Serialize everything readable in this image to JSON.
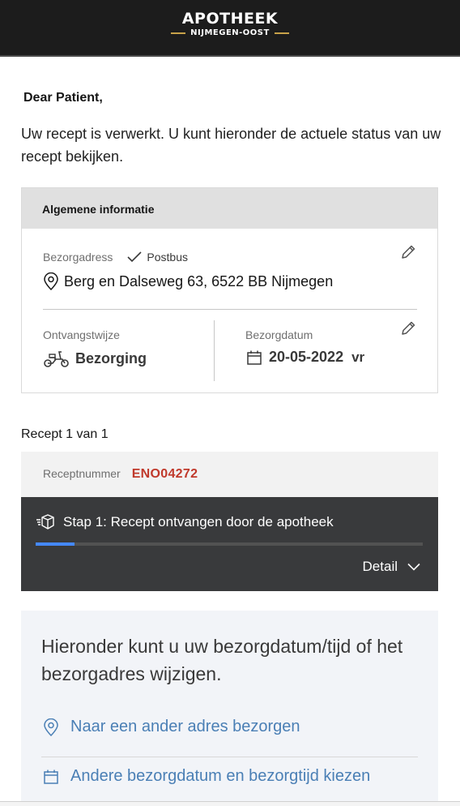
{
  "brand": {
    "name": "APOTHEEK",
    "subtitle": "NIJMEGEN-OOST",
    "accent_color": "#c8a24a"
  },
  "greeting": "Dear Patient,",
  "intro": "Uw recept is verwerkt. U kunt hieronder de actuele status van uw recept bekijken.",
  "info": {
    "header": "Algemene informatie",
    "address_label": "Bezorgadress",
    "postbus_label": "Postbus",
    "address": "Berg en Dalseweg 63, 6522 BB Nijmegen",
    "receipt_method_label": "Ontvangstwijze",
    "receipt_method": "Bezorging",
    "delivery_date_label": "Bezorgdatum",
    "delivery_date": "20-05-2022",
    "delivery_day": "vr"
  },
  "recept": {
    "count_text": "Recept 1 van 1",
    "number_label": "Receptnummer",
    "number": "ENO04272",
    "number_color": "#c0392b",
    "step_text": "Stap 1:  Recept ontvangen door de apotheek",
    "progress": 0.1,
    "progress_color": "#4589ff",
    "detail_label": "Detail"
  },
  "change": {
    "title": "Hieronder kunt u uw bezorgdatum/tijd of het bezorgadres wijzigen.",
    "link_address": "Naar een ander adres bezorgen",
    "link_date": "Andere bezorgdatum en bezorgtijd kiezen"
  }
}
